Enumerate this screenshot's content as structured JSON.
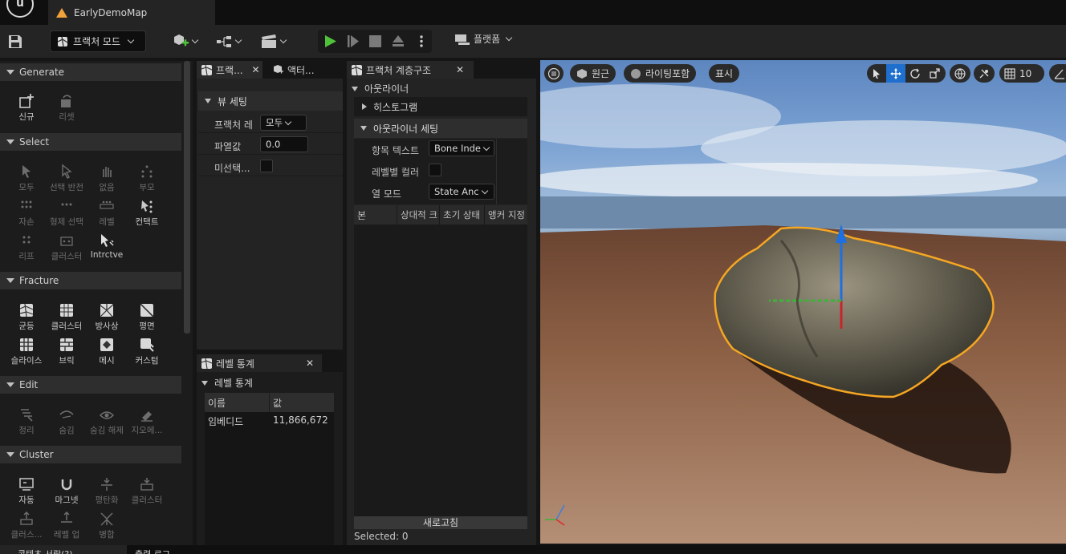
{
  "title_bar": {
    "map_name": "EarlyDemoMap"
  },
  "toolbar": {
    "mode_label": "프랙처 모드",
    "platform_label": "플랫폼"
  },
  "left_panel": {
    "sections": {
      "generate": {
        "title": "Generate",
        "tools": [
          "신규",
          "리셋"
        ]
      },
      "select": {
        "title": "Select",
        "tools": [
          "모두",
          "선택 반전",
          "없음",
          "부모",
          "자손",
          "형제 선택",
          "레벨",
          "컨택트",
          "리프",
          "클러스터",
          "Intrctve"
        ]
      },
      "fracture": {
        "title": "Fracture",
        "tools": [
          "균등",
          "클러스터",
          "방사상",
          "평면",
          "슬라이스",
          "브릭",
          "메시",
          "커스텀"
        ]
      },
      "edit": {
        "title": "Edit",
        "tools": [
          "정리",
          "숨김",
          "숨김 해제",
          "지오메..."
        ]
      },
      "cluster": {
        "title": "Cluster",
        "tools": [
          "자동",
          "마그넷",
          "평탄화",
          "클러스터",
          "클러스...",
          "레벨 업",
          "병합"
        ]
      }
    }
  },
  "fracture_panel": {
    "tab_fracture": "프랙...",
    "tab_actor": "액터...",
    "view_settings": "뷰 세팅",
    "rows": {
      "fracture_level_label": "프랙처 레",
      "fracture_level_value": "모두",
      "explode_label": "파열값",
      "explode_value": "0.0",
      "unselected_label": "미선택..."
    }
  },
  "level_stats_panel": {
    "title": "레벨 통계",
    "section": "레벨 통계",
    "col_name": "이름",
    "col_value": "값",
    "row_name": "임베디드",
    "row_value": "11,866,672"
  },
  "hierarchy_panel": {
    "title": "프랙처 계층구조",
    "outliner": "아웃라이너",
    "histogram": "히스토그램",
    "outliner_settings": "아웃라이너 세팅",
    "item_text_label": "항목 텍스트",
    "item_text_value": "Bone Inde",
    "level_color_label": "레벨별 컬러",
    "column_mode_label": "열 모드",
    "column_mode_value": "State Anc",
    "columns": [
      "본",
      "상대적 크",
      "초기 상태",
      "앵커 지정"
    ],
    "refresh": "새로고침",
    "selected": "Selected: 0"
  },
  "viewport": {
    "perspective": "원근",
    "lighting": "라이팅포함",
    "show": "표시",
    "grid_snap": "10"
  },
  "bottom_bar": {
    "tab1": "콘텐츠 서랍(?)",
    "tab2": "출력 로그"
  },
  "colors": {
    "selection_outline": "#f5a623",
    "play_green": "#4fc13a",
    "accent_blue": "#1f6fcf"
  }
}
